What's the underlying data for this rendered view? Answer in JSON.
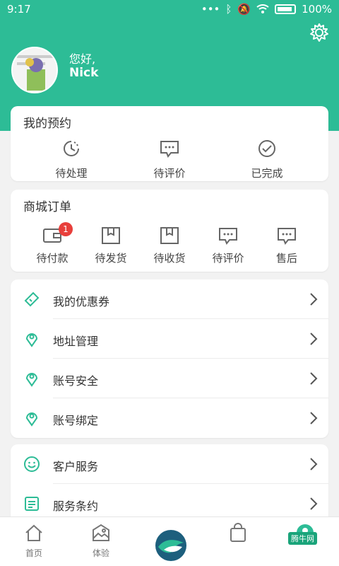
{
  "status_bar": {
    "time": "9:17",
    "battery": "100%"
  },
  "profile": {
    "greeting": "您好,",
    "username": "Nick"
  },
  "appointments": {
    "title": "我的预约",
    "items": [
      {
        "label": "待处理",
        "icon": "clock-icon"
      },
      {
        "label": "待评价",
        "icon": "comment-icon"
      },
      {
        "label": "已完成",
        "icon": "check-circle-icon"
      }
    ]
  },
  "mall_orders": {
    "title": "商城订单",
    "items": [
      {
        "label": "待付款",
        "icon": "wallet-icon",
        "badge": "1"
      },
      {
        "label": "待发货",
        "icon": "box-icon"
      },
      {
        "label": "待收货",
        "icon": "box-icon"
      },
      {
        "label": "待评价",
        "icon": "comment-icon"
      },
      {
        "label": "售后",
        "icon": "comment-icon"
      }
    ]
  },
  "menu1": [
    {
      "label": "我的优惠券",
      "icon": "coupon-icon"
    },
    {
      "label": "地址管理",
      "icon": "location-icon"
    },
    {
      "label": "账号安全",
      "icon": "location-icon"
    },
    {
      "label": "账号绑定",
      "icon": "location-icon"
    }
  ],
  "menu2": [
    {
      "label": "客户服务",
      "icon": "smile-icon"
    },
    {
      "label": "服务条约",
      "icon": "document-icon"
    }
  ],
  "tabs": [
    {
      "label": "首页",
      "icon": "home-icon"
    },
    {
      "label": "体验",
      "icon": "gallery-icon"
    },
    {
      "label": "",
      "icon": "bird-logo-icon"
    },
    {
      "label": "",
      "icon": "bag-icon"
    },
    {
      "label": "",
      "icon": "profile-icon"
    }
  ],
  "watermark": "腾牛网",
  "colors": {
    "brand": "#2dbc96",
    "badge": "#e83f3b"
  }
}
